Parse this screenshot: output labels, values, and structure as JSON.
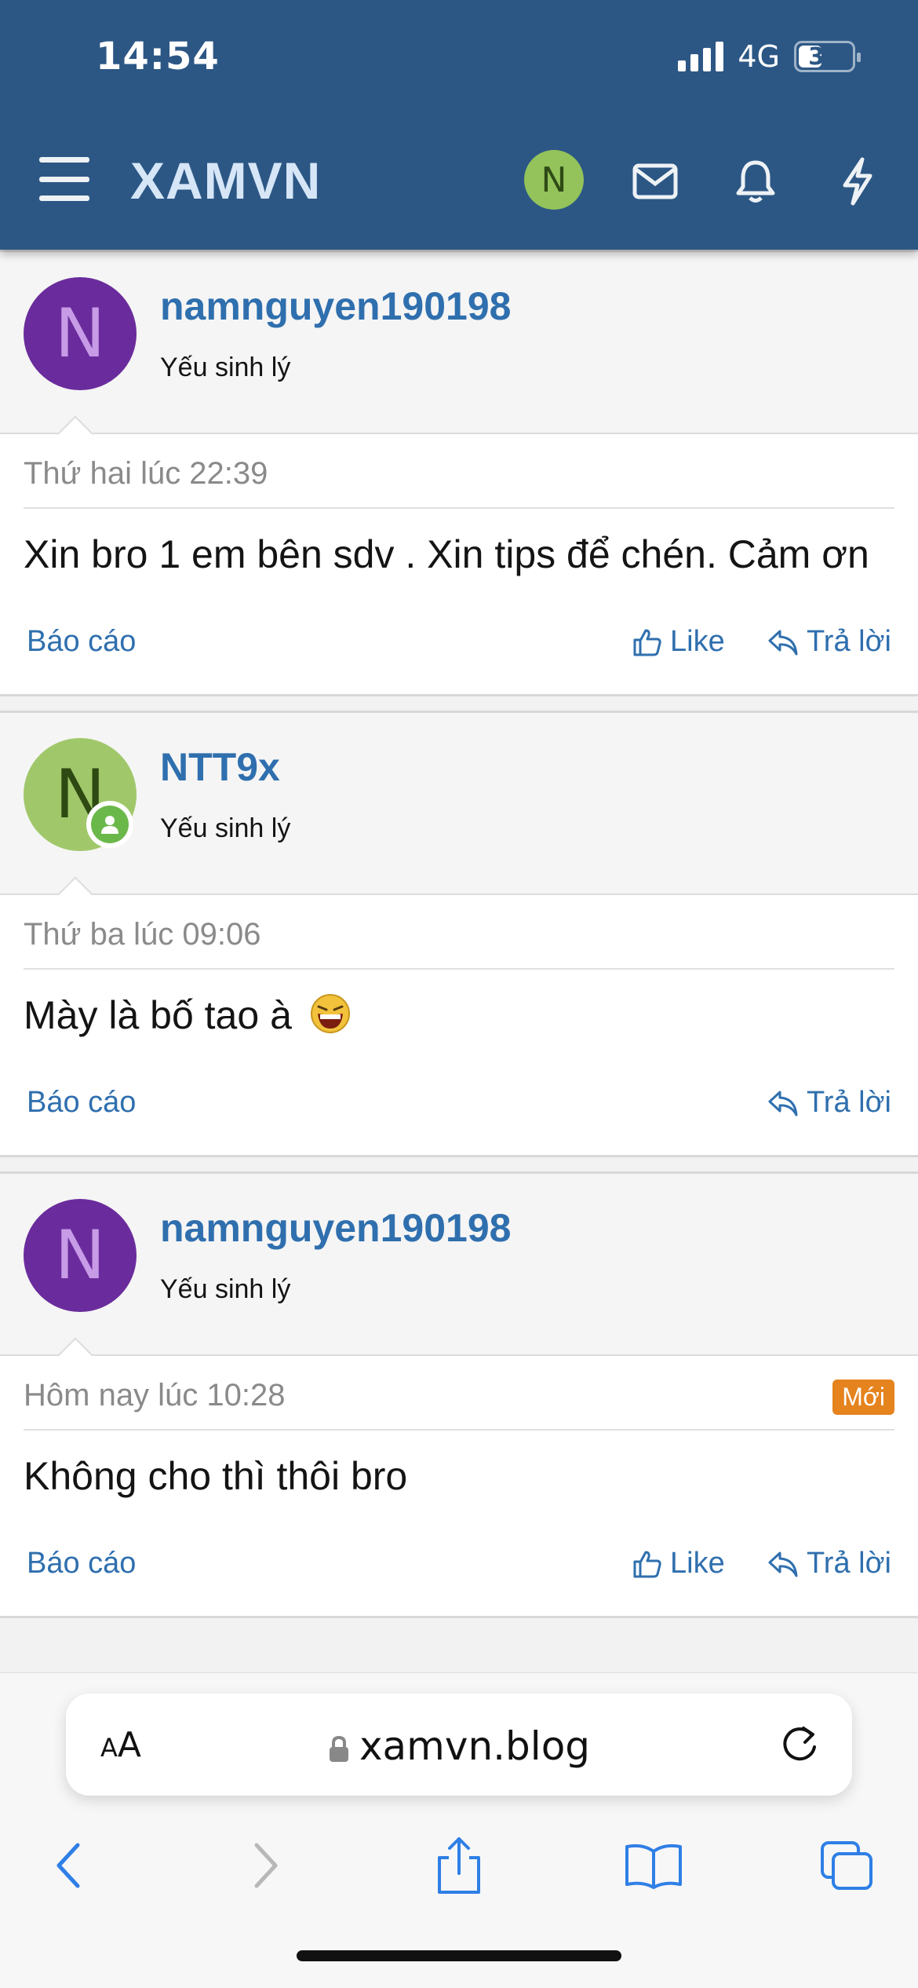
{
  "status_bar": {
    "time": "14:54",
    "network": "4G",
    "battery": "38"
  },
  "header": {
    "brand": "XAMVN",
    "avatar_letter": "N"
  },
  "posts": [
    {
      "avatar_letter": "N",
      "username": "namnguyen190198",
      "user_title": "Yếu sinh lý",
      "date": "Thứ hai lúc 22:39",
      "text": "Xin bro 1 em bên sdv . Xin tips để chén. Cảm ơn",
      "report_label": "Báo cáo",
      "like_label": "Like",
      "reply_label": "Trả lời"
    },
    {
      "avatar_letter": "N",
      "username": "NTT9x",
      "user_title": "Yếu sinh lý",
      "date": "Thứ ba lúc 09:06",
      "text": "Mày là bố tao à",
      "report_label": "Báo cáo",
      "reply_label": "Trả lời"
    },
    {
      "avatar_letter": "N",
      "username": "namnguyen190198",
      "user_title": "Yếu sinh lý",
      "date": "Hôm nay lúc 10:28",
      "badge": "Mới",
      "text": "Không cho thì thôi bro",
      "report_label": "Báo cáo",
      "like_label": "Like",
      "reply_label": "Trả lời"
    }
  ],
  "browser": {
    "aa_small": "A",
    "aa_large": "A",
    "url": "xamvn.blog"
  },
  "colors": {
    "header_bg": "#2c5785",
    "link": "#2f6fae",
    "badge_new": "#e5831e"
  }
}
